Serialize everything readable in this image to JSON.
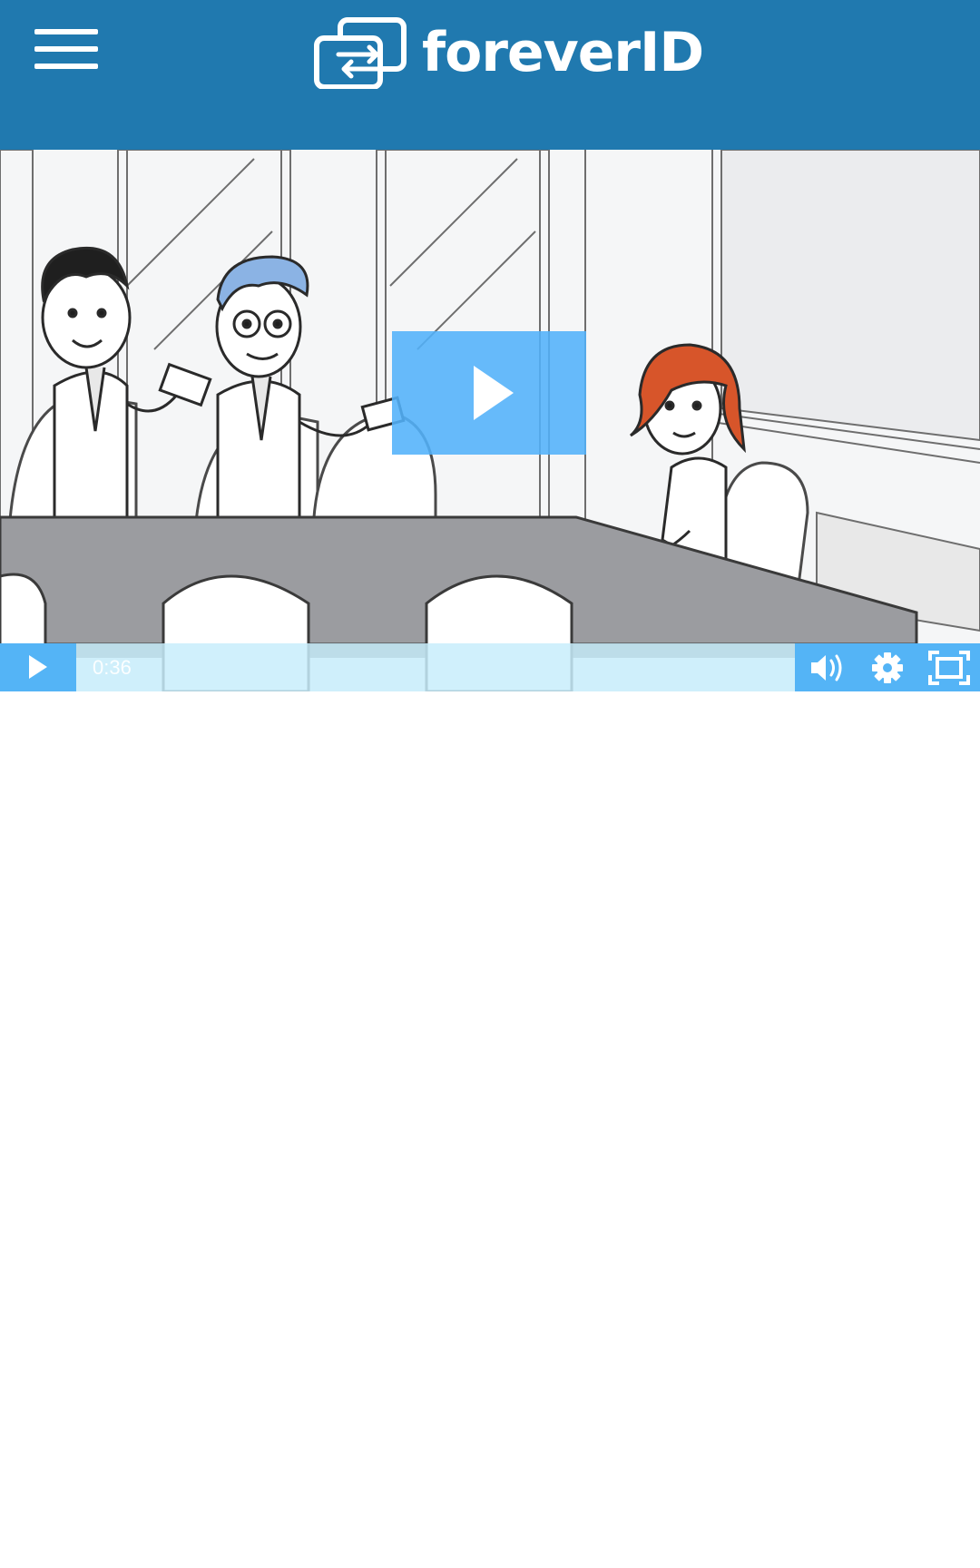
{
  "header": {
    "logo_text": "foreverID",
    "background_color": "#2079af",
    "menu_icon": "hamburger-menu-icon",
    "logo_icon": "swap-arrows-icon"
  },
  "video": {
    "current_time": "0:36",
    "accent_color": "#54b4f6",
    "big_play_icon": "play-icon",
    "controls": {
      "play_icon": "play-icon",
      "volume_icon": "volume-icon",
      "settings_icon": "gear-icon",
      "fullscreen_icon": "fullscreen-icon"
    }
  }
}
